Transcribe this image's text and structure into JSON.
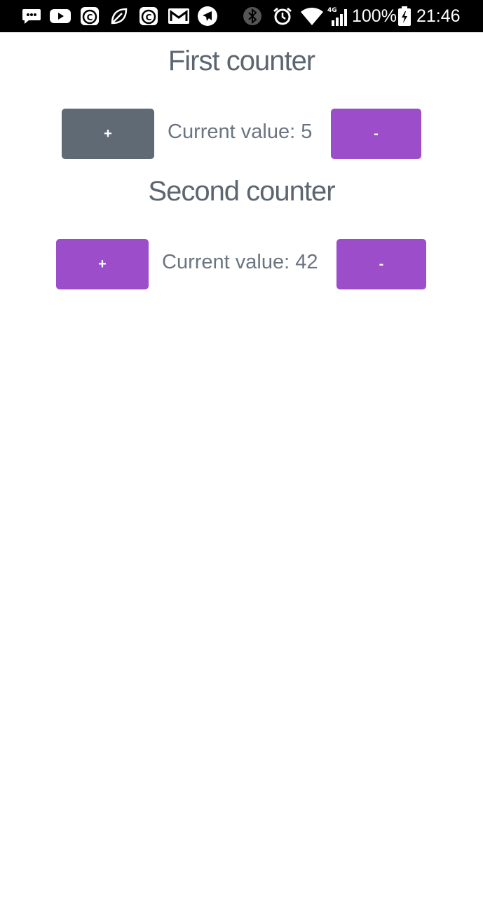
{
  "status_bar": {
    "battery_percent": "100%",
    "time": "21:46",
    "network": "4G",
    "icons_left": [
      "chat-icon",
      "youtube-icon",
      "c-app-icon",
      "leaf-icon",
      "c-app-icon",
      "gmail-icon",
      "telegram-icon"
    ],
    "icons_right": [
      "bluetooth-icon",
      "alarm-icon",
      "wifi-icon",
      "signal-icon",
      "battery-charging-icon"
    ]
  },
  "counters": [
    {
      "title": "First counter",
      "increment_label": "+",
      "decrement_label": "-",
      "value_text": "Current value: 5",
      "value": 5,
      "increment_color": "#5f6a74",
      "decrement_color": "#9b4dca"
    },
    {
      "title": "Second counter",
      "increment_label": "+",
      "decrement_label": "-",
      "value_text": "Current value: 42",
      "value": 42,
      "increment_color": "#9b4dca",
      "decrement_color": "#9b4dca"
    }
  ]
}
